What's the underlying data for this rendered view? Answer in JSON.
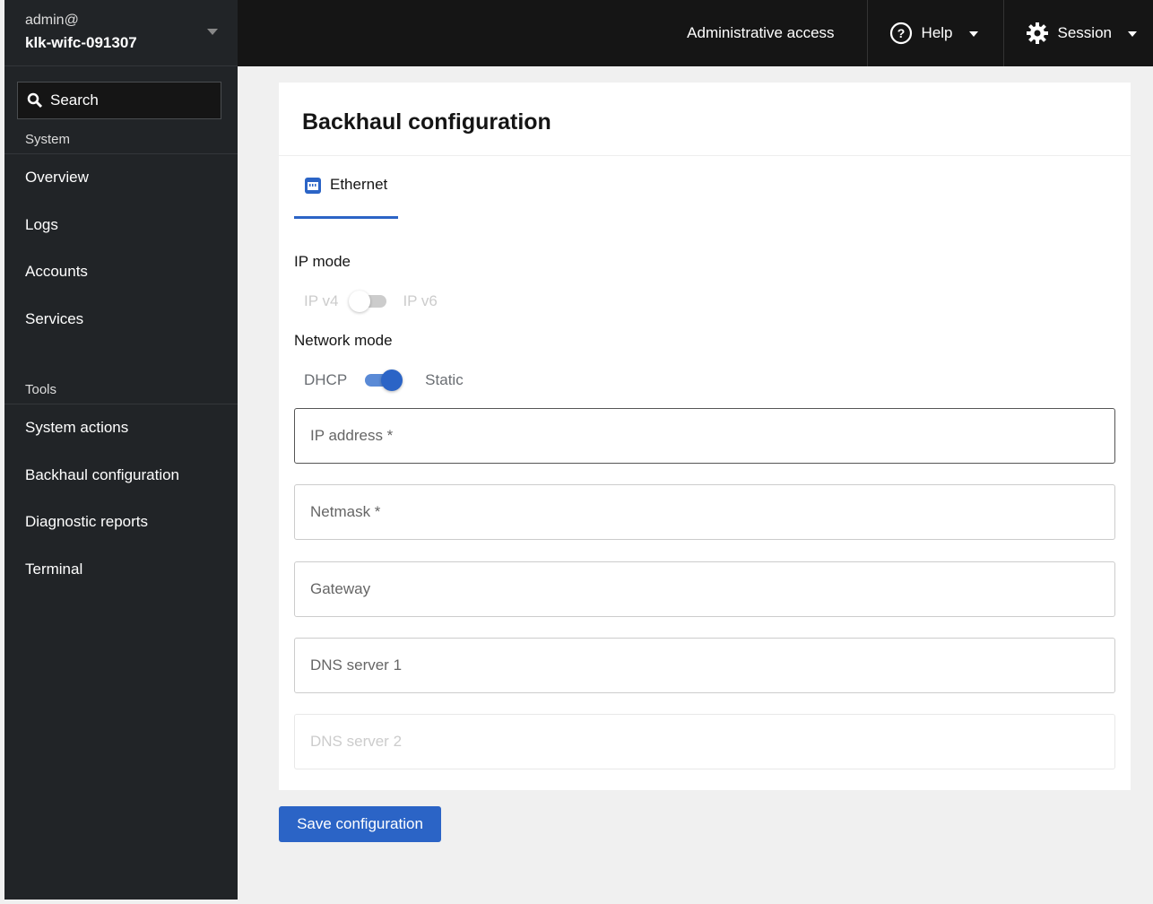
{
  "host": {
    "user": "admin@",
    "hostname": "klk-wifc-091307"
  },
  "search": {
    "placeholder": "Search"
  },
  "sidebar": {
    "sections": [
      {
        "label": "System",
        "items": [
          "Overview",
          "Logs",
          "Accounts",
          "Services"
        ]
      },
      {
        "label": "Tools",
        "items": [
          "System actions",
          "Backhaul configuration",
          "Diagnostic reports",
          "Terminal"
        ]
      }
    ]
  },
  "topbar": {
    "admin": "Administrative access",
    "help": "Help",
    "session": "Session"
  },
  "card": {
    "title": "Backhaul configuration",
    "tab": "Ethernet",
    "ip_mode": {
      "label": "IP mode",
      "left": "IP v4",
      "right": "IP v6"
    },
    "network_mode": {
      "label": "Network mode",
      "left": "DHCP",
      "right": "Static"
    },
    "fields": [
      "IP address *",
      "Netmask *",
      "Gateway",
      "DNS server 1",
      "DNS server 2"
    ]
  },
  "save": "Save configuration",
  "colors": {
    "accent": "#2b64c6"
  }
}
